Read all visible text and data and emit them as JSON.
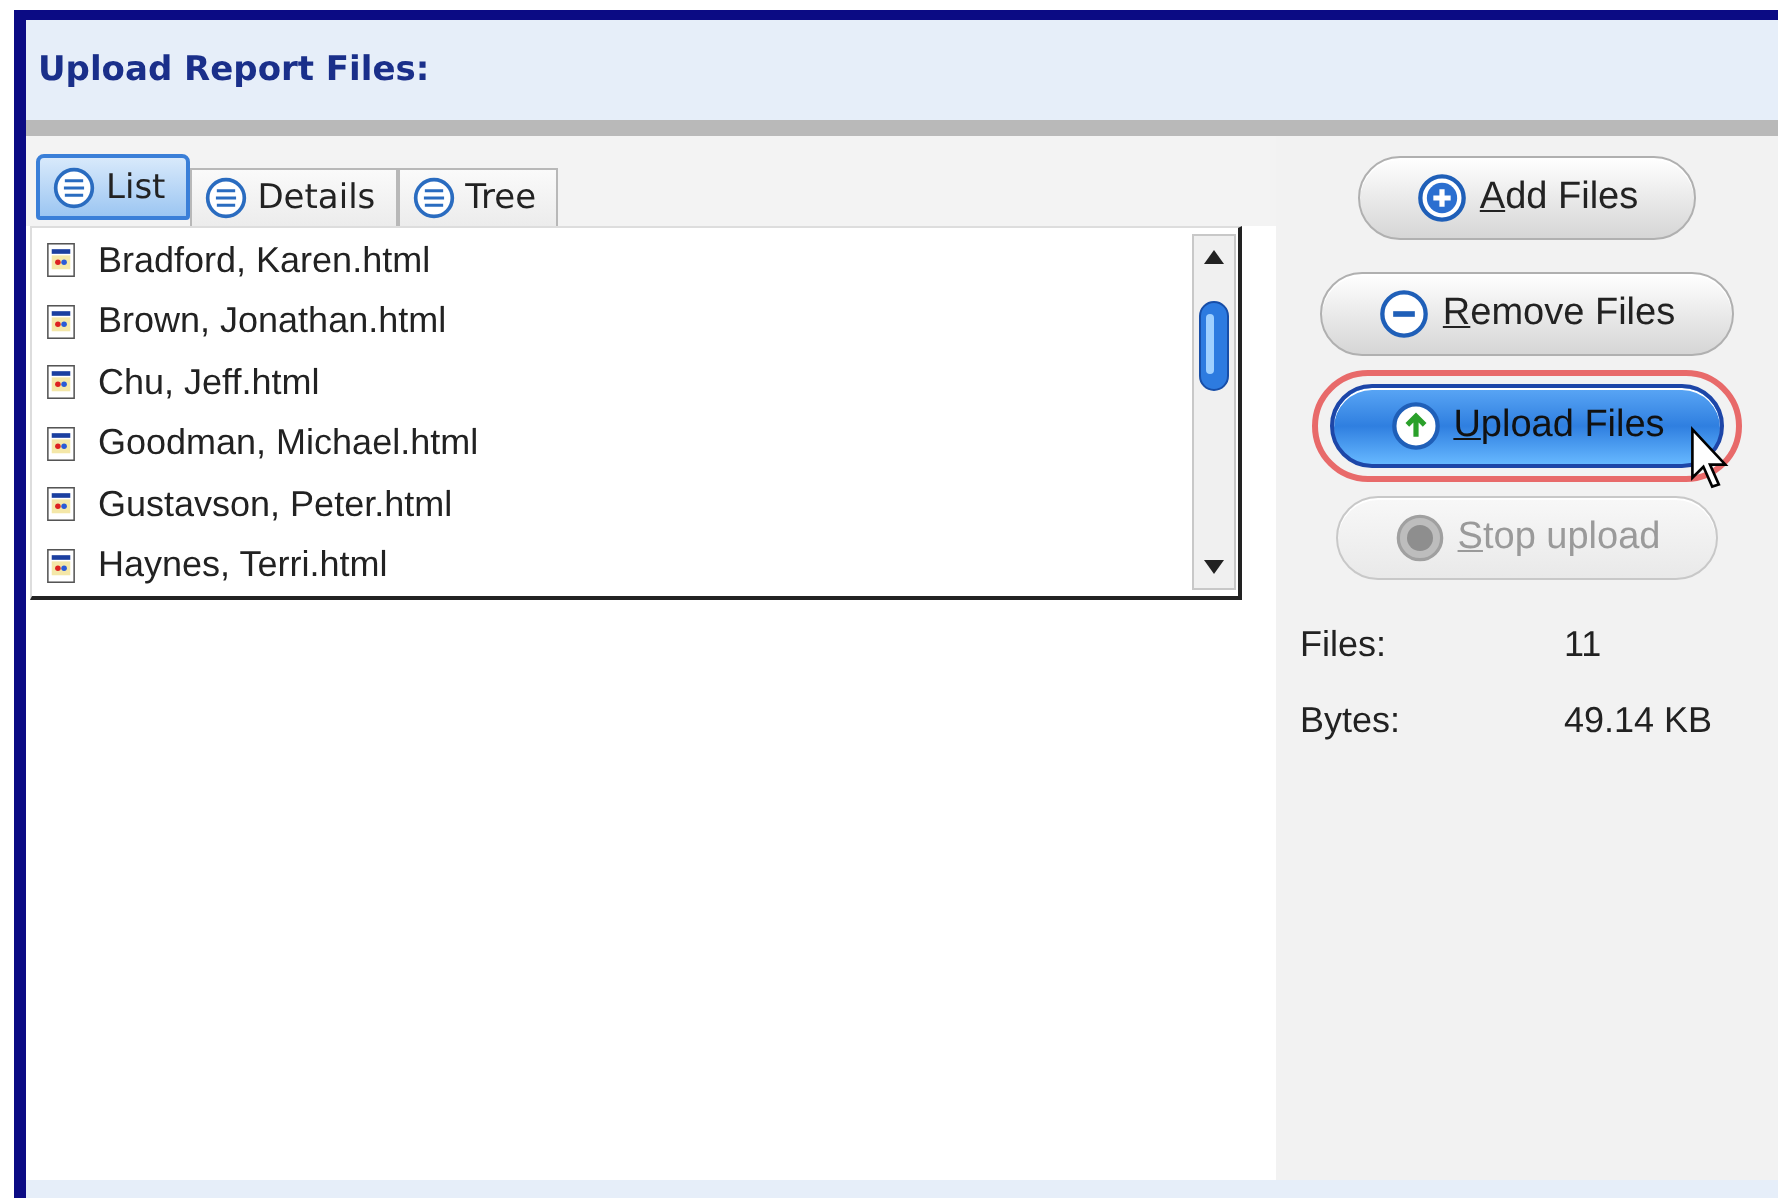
{
  "header": {
    "title": "Upload Report Files:"
  },
  "tabs": [
    {
      "label": "List",
      "selected": true
    },
    {
      "label": "Details",
      "selected": false
    },
    {
      "label": "Tree",
      "selected": false
    }
  ],
  "files": [
    {
      "name": "Bradford, Karen.html"
    },
    {
      "name": "Brown, Jonathan.html"
    },
    {
      "name": "Chu, Jeff.html"
    },
    {
      "name": "Goodman, Michael.html"
    },
    {
      "name": "Gustavson, Peter.html"
    },
    {
      "name": "Haynes, Terri.html"
    }
  ],
  "buttons": [
    {
      "label": "Add Files",
      "hovered": false,
      "disabled": false
    },
    {
      "label": "Remove Files",
      "hovered": false,
      "disabled": false
    },
    {
      "label": "Upload Files",
      "hovered": true,
      "disabled": false
    },
    {
      "label": "Stop upload",
      "hovered": false,
      "disabled": true
    }
  ],
  "stats": [
    {
      "label": "Files:",
      "value": "11"
    },
    {
      "label": "Bytes:",
      "value": "49.14 KB"
    }
  ]
}
